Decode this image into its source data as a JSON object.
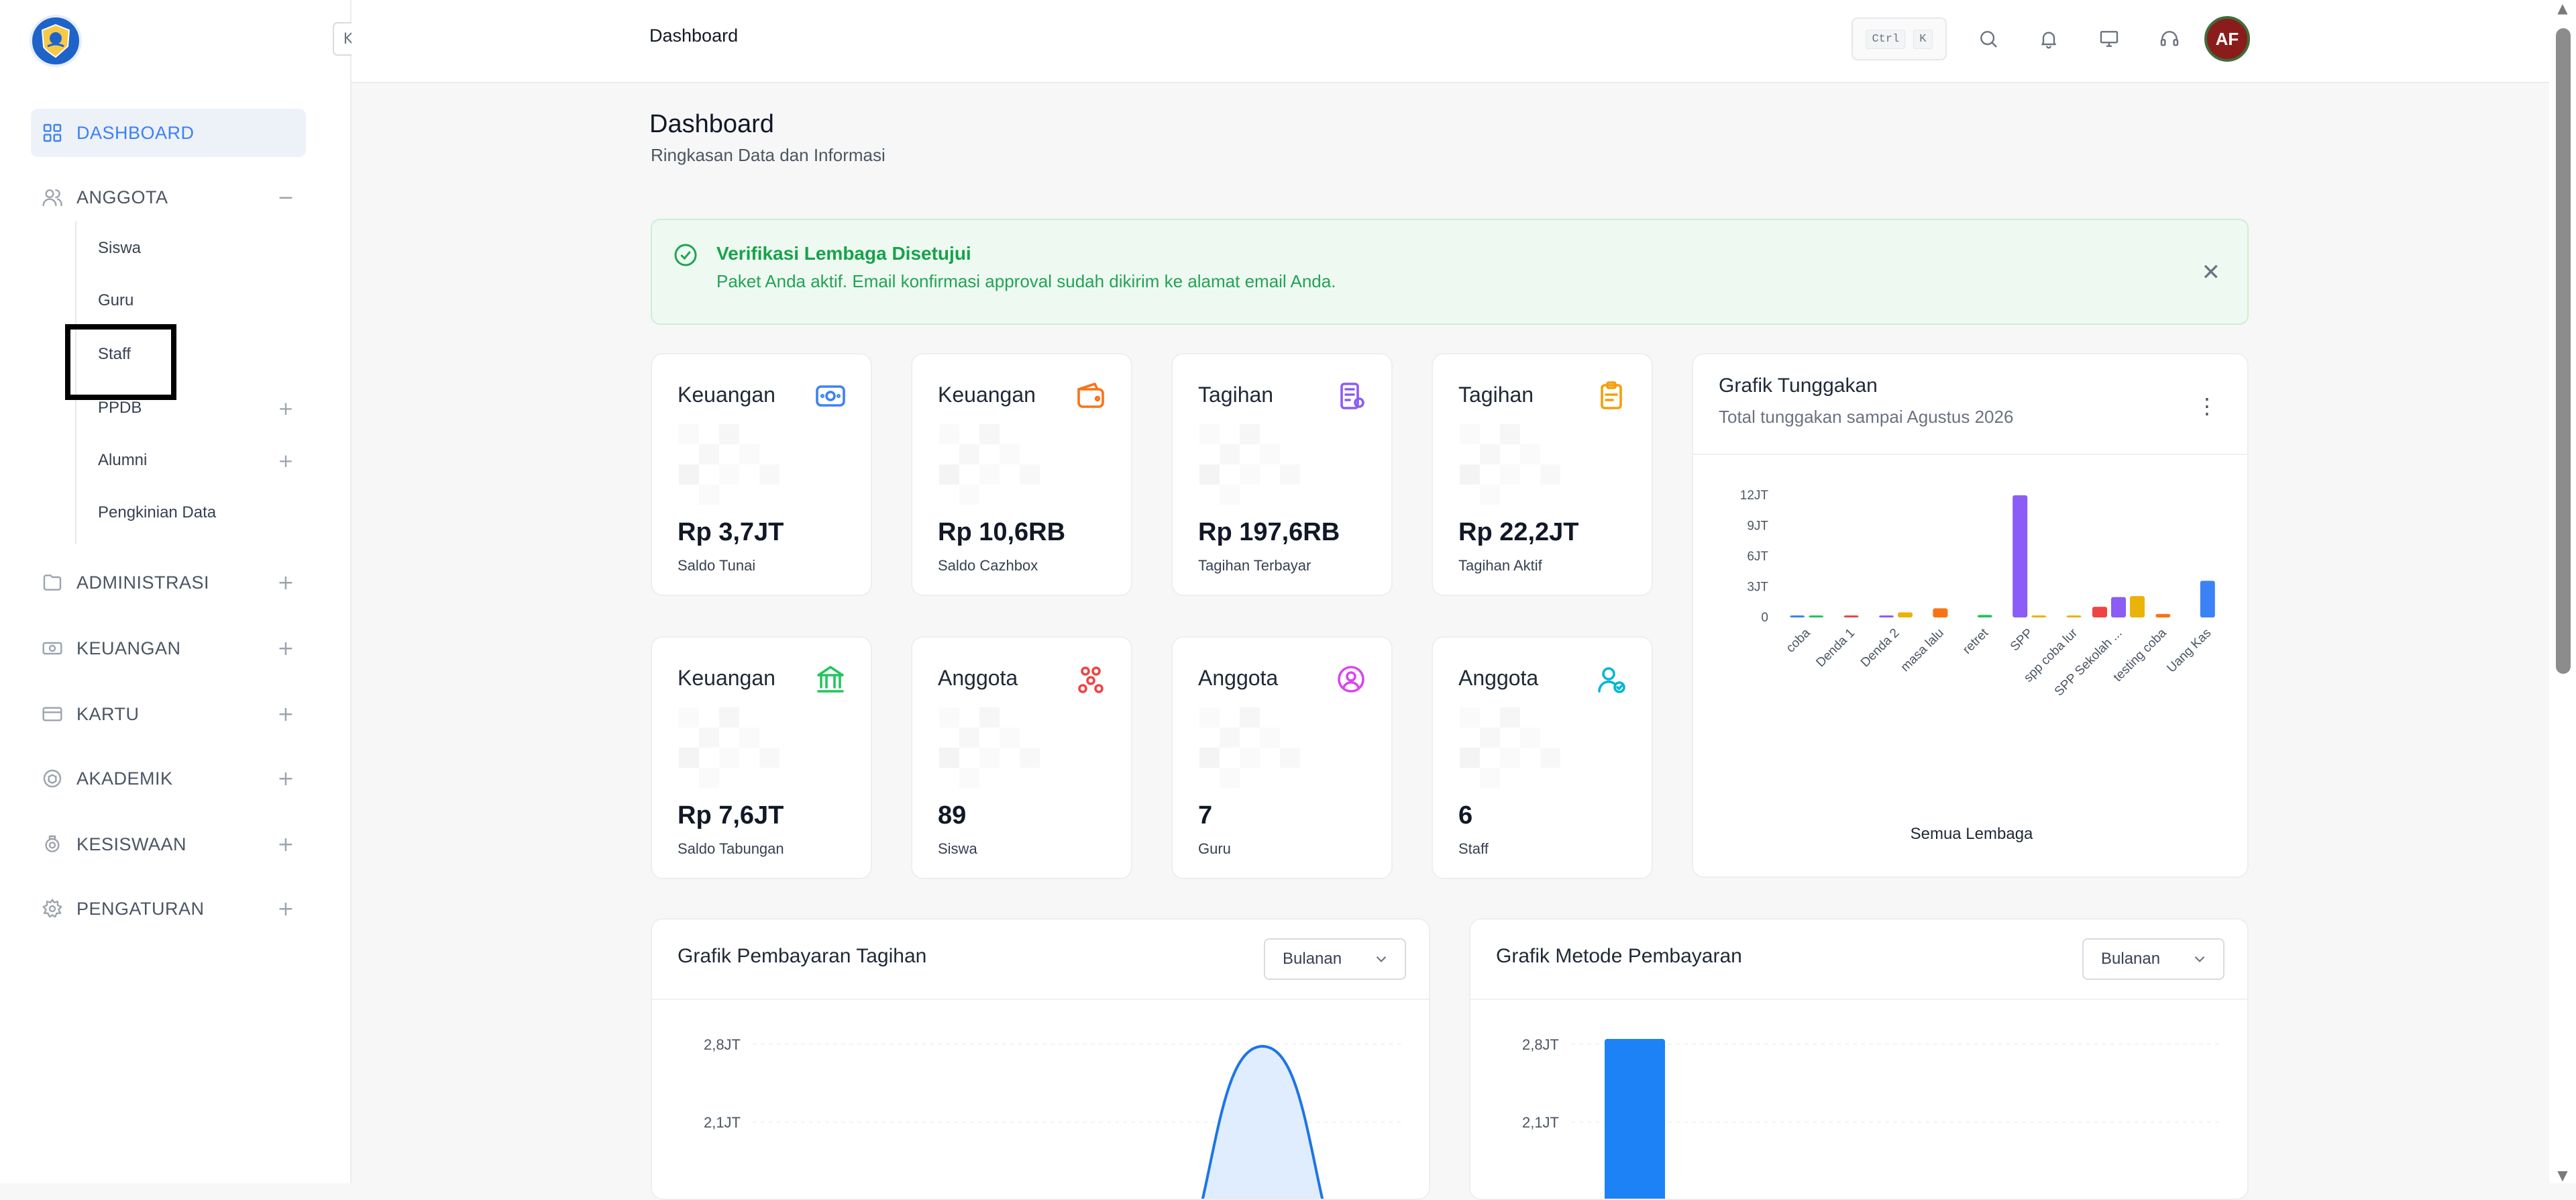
{
  "topbar": {
    "title": "Dashboard",
    "kbd_ctrl": "Ctrl",
    "kbd_k": "K",
    "avatar_initials": "AF"
  },
  "sidebar": {
    "collapse_glyph": "K",
    "items": [
      {
        "label": "DASHBOARD",
        "icon": "grid-icon",
        "active": true,
        "toggle": ""
      },
      {
        "label": "ANGGOTA",
        "icon": "users-icon",
        "active": false,
        "toggle": "−"
      },
      {
        "label": "ADMINISTRASI",
        "icon": "folder-icon",
        "active": false,
        "toggle": "+"
      },
      {
        "label": "KEUANGAN",
        "icon": "money-icon",
        "active": false,
        "toggle": "+"
      },
      {
        "label": "KARTU",
        "icon": "card-icon",
        "active": false,
        "toggle": "+"
      },
      {
        "label": "AKADEMIK",
        "icon": "book-icon",
        "active": false,
        "toggle": "+"
      },
      {
        "label": "KESISWAAN",
        "icon": "badge-icon",
        "active": false,
        "toggle": "+"
      },
      {
        "label": "PENGATURAN",
        "icon": "gear-icon",
        "active": false,
        "toggle": "+"
      }
    ],
    "sub_items": [
      {
        "label": "Siswa",
        "toggle": ""
      },
      {
        "label": "Guru",
        "toggle": ""
      },
      {
        "label": "Staff",
        "toggle": ""
      },
      {
        "label": "PPDB",
        "toggle": "+"
      },
      {
        "label": "Alumni",
        "toggle": "+"
      },
      {
        "label": "Pengkinian Data",
        "toggle": ""
      }
    ]
  },
  "page": {
    "title": "Dashboard",
    "subtitle": "Ringkasan Data dan Informasi"
  },
  "alert": {
    "title": "Verifikasi Lembaga Disetujui",
    "message": "Paket Anda aktif. Email konfirmasi approval sudah dikirim ke alamat email Anda.",
    "color": "#16a34a"
  },
  "cards": [
    {
      "title": "Keuangan",
      "value": "Rp 3,7JT",
      "label": "Saldo Tunai",
      "icon": "wallet-icon",
      "color": "#3b82f6"
    },
    {
      "title": "Keuangan",
      "value": "Rp 10,6RB",
      "label": "Saldo Cazhbox",
      "icon": "purse-icon",
      "color": "#f97316"
    },
    {
      "title": "Tagihan",
      "value": "Rp 197,6RB",
      "label": "Tagihan Terbayar",
      "icon": "invoice-icon",
      "color": "#8b5cf6"
    },
    {
      "title": "Tagihan",
      "value": "Rp 22,2JT",
      "label": "Tagihan Aktif",
      "icon": "clipboard-icon",
      "color": "#f59e0b"
    },
    {
      "title": "Keuangan",
      "value": "Rp 7,6JT",
      "label": "Saldo Tabungan",
      "icon": "bank-icon",
      "color": "#22c55e"
    },
    {
      "title": "Anggota",
      "value": "89",
      "label": "Siswa",
      "icon": "group-icon",
      "color": "#ef4444"
    },
    {
      "title": "Anggota",
      "value": "7",
      "label": "Guru",
      "icon": "user-circle-icon",
      "color": "#d946ef"
    },
    {
      "title": "Anggota",
      "value": "6",
      "label": "Staff",
      "icon": "user-check-icon",
      "color": "#06b6d4"
    }
  ],
  "tunggakan": {
    "title": "Grafik Tunggakan",
    "subtitle": "Total tunggakan sampai Agustus 2026"
  },
  "pembayaran_tagihan": {
    "title": "Grafik Pembayaran Tagihan",
    "select": "Bulanan"
  },
  "metode_pembayaran": {
    "title": "Grafik Metode Pembayaran",
    "select": "Bulanan"
  },
  "chart_data": [
    {
      "type": "bar",
      "name": "Grafik Tunggakan",
      "categories": [
        "coba",
        "Denda 1",
        "Denda 2",
        "masa lalu",
        "retret",
        "SPP",
        "spp coba lur",
        "SPP Sekolah ...",
        "testing coba",
        "Uang Kas"
      ],
      "series": [
        {
          "color": "#3b82f6",
          "values": [
            0.15,
            0,
            0,
            0,
            0,
            0,
            0,
            0,
            0,
            3.6
          ]
        },
        {
          "color": "#22c55e",
          "values": [
            0.1,
            0,
            0,
            0,
            0.25,
            0,
            0,
            0,
            0,
            0
          ]
        },
        {
          "color": "#ef4444",
          "values": [
            0,
            0.12,
            0,
            0,
            0,
            0,
            0,
            1.05,
            0,
            0
          ]
        },
        {
          "color": "#8b5cf6",
          "values": [
            0,
            0,
            0.1,
            0,
            0,
            12,
            0,
            2.0,
            0,
            0
          ]
        },
        {
          "color": "#eab308",
          "values": [
            0,
            0,
            0.5,
            0,
            0,
            0.15,
            0.1,
            2.1,
            0,
            0
          ]
        },
        {
          "color": "#f97316",
          "values": [
            0,
            0,
            0,
            0.9,
            0,
            0,
            0,
            0,
            0.35,
            0
          ]
        }
      ],
      "ylim": [
        0,
        12
      ],
      "yticks": [
        "0",
        "3JT",
        "6JT",
        "9JT",
        "12JT"
      ],
      "xlabel": "Semua Lembaga",
      "grid": false
    },
    {
      "type": "area",
      "name": "Grafik Pembayaran Tagihan",
      "y_tick_labels": [
        "2,8JT",
        "2,1JT"
      ],
      "ylim": [
        0,
        2.8
      ],
      "peak_value": 2.8,
      "color": "#1d75e8"
    },
    {
      "type": "bar",
      "name": "Grafik Metode Pembayaran",
      "y_tick_labels": [
        "2,8JT",
        "2,1JT"
      ],
      "ylim": [
        0,
        2.8
      ],
      "values": [
        2.8
      ],
      "color": "#1d82f6"
    }
  ]
}
